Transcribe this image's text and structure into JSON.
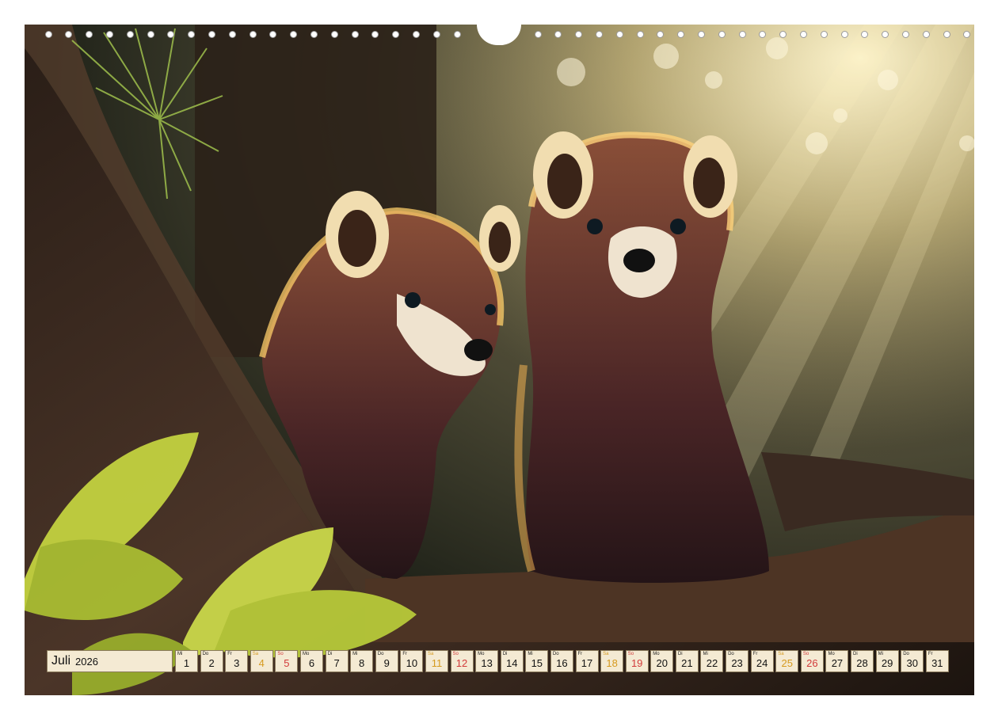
{
  "calendar": {
    "month": "Juli",
    "year": "2026",
    "days": [
      {
        "dow": "Mi",
        "num": "1",
        "kind": "weekday"
      },
      {
        "dow": "Do",
        "num": "2",
        "kind": "weekday"
      },
      {
        "dow": "Fr",
        "num": "3",
        "kind": "weekday"
      },
      {
        "dow": "Sa",
        "num": "4",
        "kind": "sat"
      },
      {
        "dow": "So",
        "num": "5",
        "kind": "sun"
      },
      {
        "dow": "Mo",
        "num": "6",
        "kind": "weekday"
      },
      {
        "dow": "Di",
        "num": "7",
        "kind": "weekday"
      },
      {
        "dow": "Mi",
        "num": "8",
        "kind": "weekday"
      },
      {
        "dow": "Do",
        "num": "9",
        "kind": "weekday"
      },
      {
        "dow": "Fr",
        "num": "10",
        "kind": "weekday"
      },
      {
        "dow": "Sa",
        "num": "11",
        "kind": "sat"
      },
      {
        "dow": "So",
        "num": "12",
        "kind": "sun"
      },
      {
        "dow": "Mo",
        "num": "13",
        "kind": "weekday"
      },
      {
        "dow": "Di",
        "num": "14",
        "kind": "weekday"
      },
      {
        "dow": "Mi",
        "num": "15",
        "kind": "weekday"
      },
      {
        "dow": "Do",
        "num": "16",
        "kind": "weekday"
      },
      {
        "dow": "Fr",
        "num": "17",
        "kind": "weekday"
      },
      {
        "dow": "Sa",
        "num": "18",
        "kind": "sat"
      },
      {
        "dow": "So",
        "num": "19",
        "kind": "sun"
      },
      {
        "dow": "Mo",
        "num": "20",
        "kind": "weekday"
      },
      {
        "dow": "Di",
        "num": "21",
        "kind": "weekday"
      },
      {
        "dow": "Mi",
        "num": "22",
        "kind": "weekday"
      },
      {
        "dow": "Do",
        "num": "23",
        "kind": "weekday"
      },
      {
        "dow": "Fr",
        "num": "24",
        "kind": "weekday"
      },
      {
        "dow": "Sa",
        "num": "25",
        "kind": "sat"
      },
      {
        "dow": "So",
        "num": "26",
        "kind": "sun"
      },
      {
        "dow": "Mo",
        "num": "27",
        "kind": "weekday"
      },
      {
        "dow": "Di",
        "num": "28",
        "kind": "weekday"
      },
      {
        "dow": "Mi",
        "num": "29",
        "kind": "weekday"
      },
      {
        "dow": "Do",
        "num": "30",
        "kind": "weekday"
      },
      {
        "dow": "Fr",
        "num": "31",
        "kind": "weekday"
      }
    ]
  },
  "colors": {
    "cell_background": "#f4ead3",
    "saturday": "#d69a1e",
    "sunday": "#d23a3a"
  }
}
